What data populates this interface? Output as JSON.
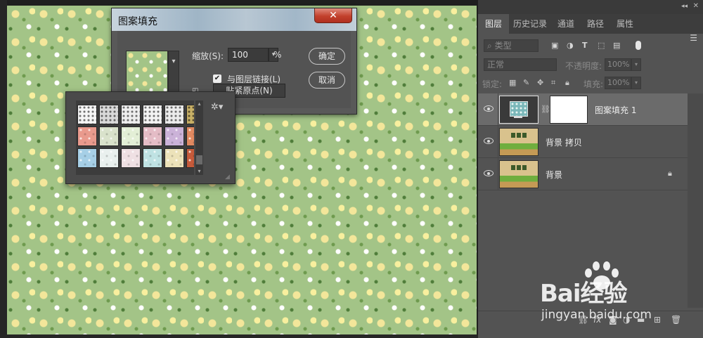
{
  "dialog": {
    "title": "图案填充",
    "close_icon": "close-icon",
    "scale_label": "缩放(S):",
    "scale_value": "100",
    "scale_unit": "%",
    "link_checkbox_checked": true,
    "link_label": "与图层链接(L)",
    "snap_label": "贴紧原点(N)",
    "ok_label": "确定",
    "cancel_label": "取消"
  },
  "picker": {
    "swatch_colors": [
      [
        "#f5f5f5",
        "#d9d9d9",
        "#eeeeee",
        "#f3f3f3",
        "#ececec",
        "#c8b066"
      ],
      [
        "#e99a8d",
        "#d9e2cb",
        "#e3efd6",
        "#e4bcc6",
        "#cbb2d8",
        "#e08860"
      ],
      [
        "#a6cfe6",
        "#e9f0ee",
        "#efe0e3",
        "#bfe2e3",
        "#ece2b9",
        "#c55a3a"
      ]
    ],
    "gear_icon": "gear-icon"
  },
  "panel": {
    "tabs": [
      "图层",
      "历史记录",
      "通道",
      "路径",
      "属性"
    ],
    "active_tab": "图层",
    "filter_kind": "类型",
    "blend_mode": "正常",
    "opacity_label": "不透明度:",
    "opacity_value": "100%",
    "lock_label": "锁定:",
    "fill_label": "填充:",
    "fill_value": "100%",
    "layers": [
      {
        "name": "图案填充 1",
        "visible": true,
        "selected": true,
        "kind": "pattern-fill",
        "locked": false
      },
      {
        "name": "背景 拷贝",
        "visible": true,
        "selected": false,
        "kind": "image",
        "locked": false
      },
      {
        "name": "背景",
        "visible": true,
        "selected": false,
        "kind": "image",
        "locked": true
      }
    ]
  },
  "watermark": {
    "brand": "Bai经验",
    "url": "jingyan.baidu.com"
  },
  "colors": {
    "canvas_bg": "#a3c487",
    "flower_yellow": "#f3e69a",
    "panel_bg": "#535353",
    "selected_layer": "#6b6b6b",
    "close_red": "#c2402c"
  }
}
